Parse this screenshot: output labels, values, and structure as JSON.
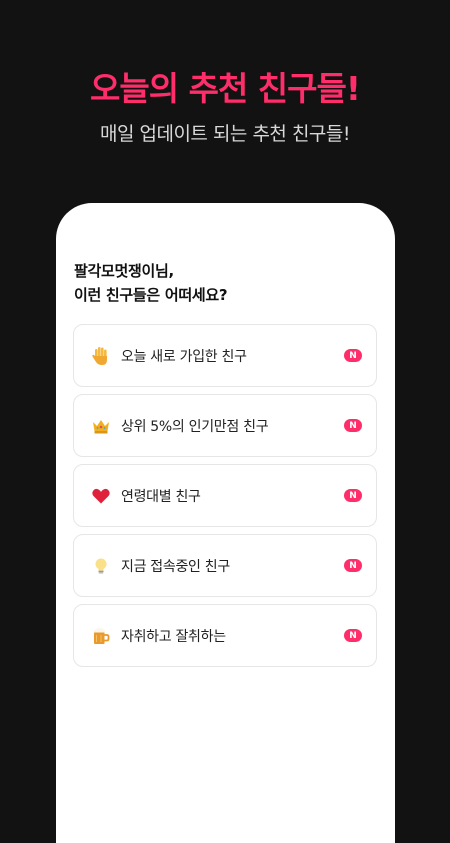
{
  "header": {
    "title": "오늘의 추천 친구들!",
    "subtitle": "매일 업데이트 되는 추천 친구들!"
  },
  "prompt": {
    "line1": "팔각모멋쟁이님,",
    "line2": "이런 친구들은 어떠세요?"
  },
  "recommendations": [
    {
      "icon": "raised-hand-icon",
      "label": "오늘 새로 가입한 친구",
      "badge": "N"
    },
    {
      "icon": "crown-icon",
      "label": "상위 5%의 인기만점 친구",
      "badge": "N"
    },
    {
      "icon": "heart-icon",
      "label": "연령대별 친구",
      "badge": "N"
    },
    {
      "icon": "lightbulb-icon",
      "label": "지금 접속중인 친구",
      "badge": "N"
    },
    {
      "icon": "beer-mug-icon",
      "label": "자취하고 잘취하는",
      "badge": "N"
    }
  ],
  "colors": {
    "background": "#121212",
    "accent": "#ff2d6a",
    "card_border": "#e6e6e6"
  }
}
